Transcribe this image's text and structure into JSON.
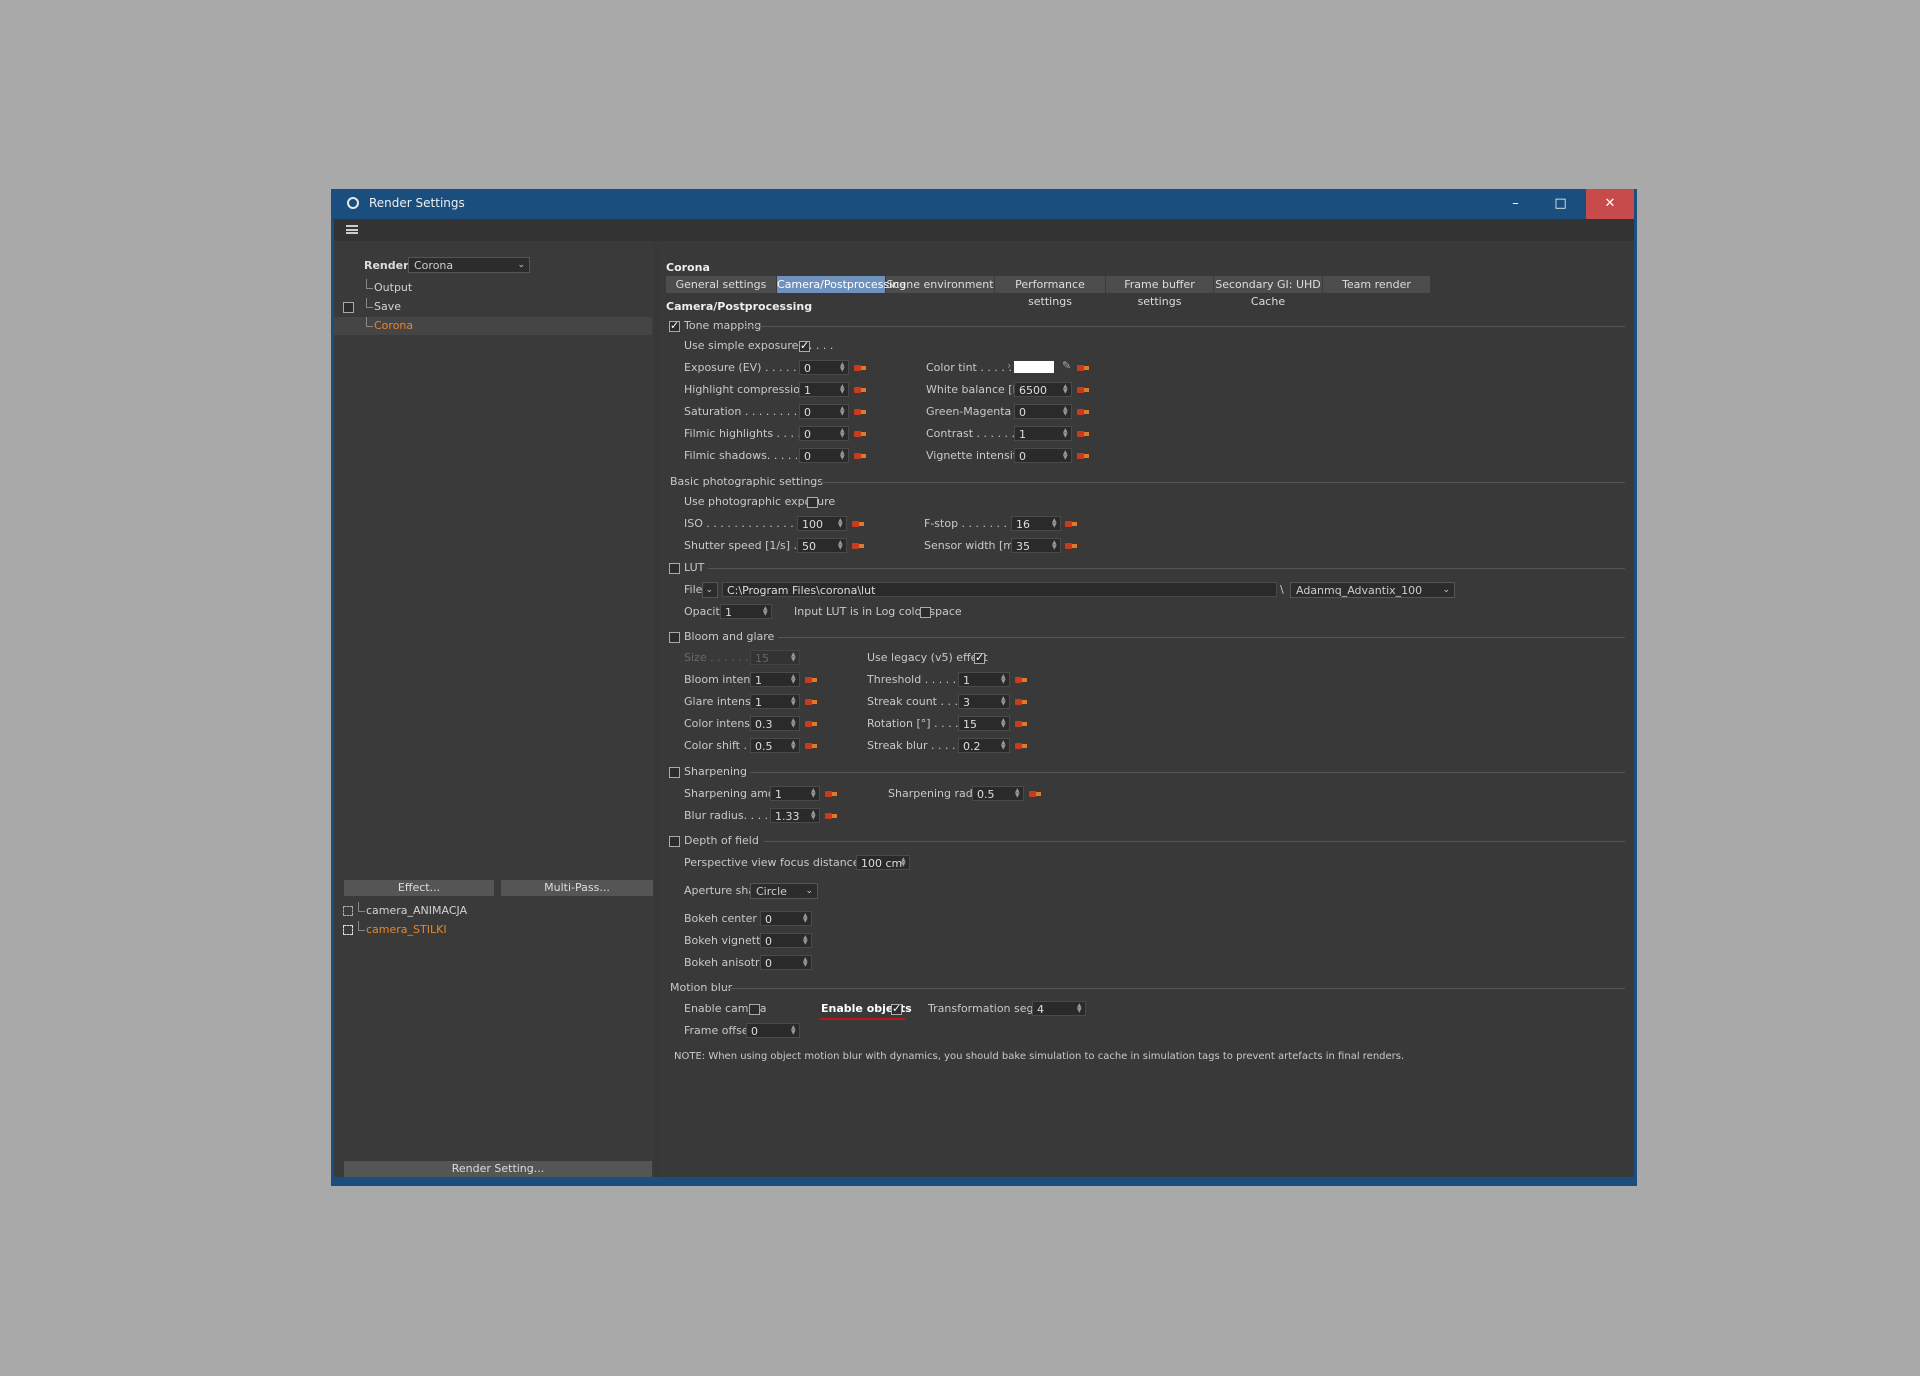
{
  "window": {
    "title": "Render Settings",
    "buttons": {
      "minimize": "–",
      "maximize": "□",
      "close": "✕"
    }
  },
  "left": {
    "renderer_label": "Renderer",
    "renderer_value": "Corona",
    "tree": [
      {
        "label": "Output",
        "checked": false
      },
      {
        "label": "Save",
        "checked": false
      },
      {
        "label": "Corona",
        "selected": true
      }
    ],
    "effect_button": "Effect...",
    "multipass_button": "Multi-Pass...",
    "cameras": [
      {
        "label": "camera_ANIMACJA",
        "active": false
      },
      {
        "label": "camera_STILKI",
        "active": true
      }
    ],
    "render_setting_button": "Render Setting..."
  },
  "right": {
    "header": "Corona",
    "tabs": [
      {
        "label": "General settings",
        "active": false
      },
      {
        "label": "Camera/Postprocessing",
        "active": true
      },
      {
        "label": "Scene environment",
        "active": false
      },
      {
        "label": "Performance settings",
        "active": false
      },
      {
        "label": "Frame buffer settings",
        "active": false
      },
      {
        "label": "Secondary GI: UHD Cache",
        "active": false
      },
      {
        "label": "Team render",
        "active": false
      }
    ],
    "section_title": "Camera/Postprocessing",
    "tone": {
      "title": "Tone mapping",
      "enabled": true,
      "use_simple_label": "Use simple exposure . . . . .",
      "use_simple": true,
      "left": [
        {
          "label": "Exposure (EV)  . . . . . . . . .",
          "value": "0"
        },
        {
          "label": "Highlight compression  . . .",
          "value": "1"
        },
        {
          "label": "Saturation . . . . . . . . . . .",
          "value": "0"
        },
        {
          "label": "Filmic highlights . . . . . . .",
          "value": "0"
        },
        {
          "label": "Filmic shadows. . . . . . . . .",
          "value": "0"
        }
      ],
      "color_tint_label": "Color tint  . . . . .",
      "color_tint": "#ffffff",
      "right": [
        {
          "label": "White balance [K] .",
          "value": "6500"
        },
        {
          "label": "Green-Magenta tint",
          "value": "0"
        },
        {
          "label": "Contrast  . . . . . . .",
          "value": "1"
        },
        {
          "label": "Vignette intensity .",
          "value": "0"
        }
      ]
    },
    "photo": {
      "title": "Basic photographic settings",
      "use_photo_label": "Use photographic exposure",
      "use_photo": false,
      "iso_label": "ISO  . . . . . . . . . . . . . . . .",
      "iso": "100",
      "shutter_label": "Shutter speed [1/s]  . . . . .",
      "shutter": "50",
      "fstop_label": "F-stop  . . . . . . . .",
      "fstop": "16",
      "sensor_label": "Sensor width [mm]",
      "sensor": "35"
    },
    "lut": {
      "title": "LUT",
      "enabled": false,
      "file_label": "File",
      "path": "C:\\Program Files\\corona\\lut",
      "sep": "\\",
      "preset": "Adanmq_Advantix_100",
      "opacity_label": "Opacity",
      "opacity": "1",
      "log_label": "Input LUT is in Log color space",
      "log": false
    },
    "bloom": {
      "title": "Bloom and glare",
      "enabled": false,
      "size_label": "Size  . . . . . . .",
      "size": "15",
      "legacy_label": "Use legacy (v5) effect",
      "legacy": true,
      "left": [
        {
          "label": "Bloom intensity",
          "value": "1"
        },
        {
          "label": "Glare intensity",
          "value": "1"
        },
        {
          "label": "Color intensity",
          "value": "0.3"
        },
        {
          "label": "Color shift . . .",
          "value": "0.5"
        }
      ],
      "right": [
        {
          "label": "Threshold . . . . . . .",
          "value": "1"
        },
        {
          "label": "Streak count  . . . . .",
          "value": "3"
        },
        {
          "label": "Rotation [°] . . . . . .",
          "value": "15"
        },
        {
          "label": "Streak blur  . . . . . .",
          "value": "0.2"
        }
      ]
    },
    "sharp": {
      "title": "Sharpening",
      "enabled": false,
      "amount_label": "Sharpening amount",
      "amount": "1",
      "radius_label": "Sharpening radius",
      "radius": "0.5",
      "blur_label": "Blur radius. . . . . .",
      "blur": "1.33"
    },
    "dof": {
      "title": "Depth of field",
      "enabled": false,
      "focus_label": "Perspective view focus distance",
      "focus": "100 cm",
      "aperture_label": "Aperture shape",
      "aperture": "Circle",
      "items": [
        {
          "label": "Bokeh center bias",
          "value": "0"
        },
        {
          "label": "Bokeh vignetting",
          "value": "0"
        },
        {
          "label": "Bokeh anisotropy",
          "value": "0"
        }
      ]
    },
    "motion": {
      "title": "Motion blur",
      "camera_label": "Enable camera",
      "camera": false,
      "objects_label": "Enable objects",
      "objects": true,
      "segments_label": "Transformation segments",
      "segments": "4",
      "offset_label": "Frame offset",
      "offset": "0",
      "note": "NOTE: When using object motion blur with dynamics, you should bake simulation to cache in simulation tags to prevent artefacts in final renders."
    }
  },
  "colors": {
    "accent": "#e8862b",
    "titlebar": "#1a4e7e",
    "active_tab": "#6e91bd",
    "close": "#c84b4b",
    "underline": "#c0141e"
  }
}
